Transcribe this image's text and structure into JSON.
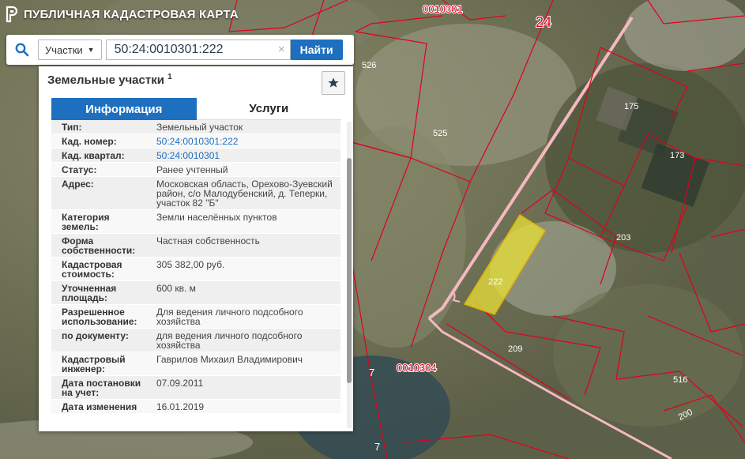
{
  "app": {
    "title": "ПУБЛИЧНАЯ КАДАСТРОВАЯ КАРТА"
  },
  "search": {
    "type_label": "Участки",
    "query": "50:24:0010301:222",
    "button": "Найти"
  },
  "panel": {
    "title": "Земельные участки",
    "count": "1",
    "tabs": [
      "Информация",
      "Услуги"
    ],
    "rows": [
      {
        "key": "Тип:",
        "value": "Земельный участок"
      },
      {
        "key": "Кад. номер:",
        "value": "50:24:0010301:222"
      },
      {
        "key": "Кад. квартал:",
        "value": "50:24:0010301"
      },
      {
        "key": "Статус:",
        "value": "Ранее учтенный"
      },
      {
        "key": "Адрес:",
        "value": "Московская область, Орехово-Зуевский район, с/о Малодубенский, д. Теперки, участок 82 \"Б\""
      },
      {
        "key": "Категория земель:",
        "value": "Земли населённых пунктов"
      },
      {
        "key": "Форма собственности:",
        "value": "Частная собственность"
      },
      {
        "key": "Кадастровая стоимость:",
        "value": "305 382,00 руб."
      },
      {
        "key": "Уточненная площадь:",
        "value": "600 кв. м"
      },
      {
        "key": "Разрешенное использование:",
        "value": "Для ведения личного подсобного хозяйства"
      },
      {
        "key": "по документу:",
        "value": "для ведения личного подсобного хозяйства"
      },
      {
        "key": "Кадастровый инженер:",
        "value": "Гаврилов Михаил Владимирович"
      },
      {
        "key": "Дата постановки на учет:",
        "value": "07.09.2011"
      },
      {
        "key": "Дата изменения",
        "value": "16.01.2019"
      }
    ]
  },
  "map": {
    "labels": {
      "q0010301": "0010301",
      "n24": "24",
      "p526": "526",
      "p525": "525",
      "p175": "175",
      "p173": "173",
      "p203": "203",
      "p222": "222",
      "p209": "209",
      "q0010304": "0010304",
      "p516": "516",
      "p200": "200",
      "n7a": "7",
      "n7b": "7"
    },
    "colors": {
      "boundary": "#e0001e",
      "road": "#f4b8c0",
      "selected": "#e8e23a"
    }
  }
}
